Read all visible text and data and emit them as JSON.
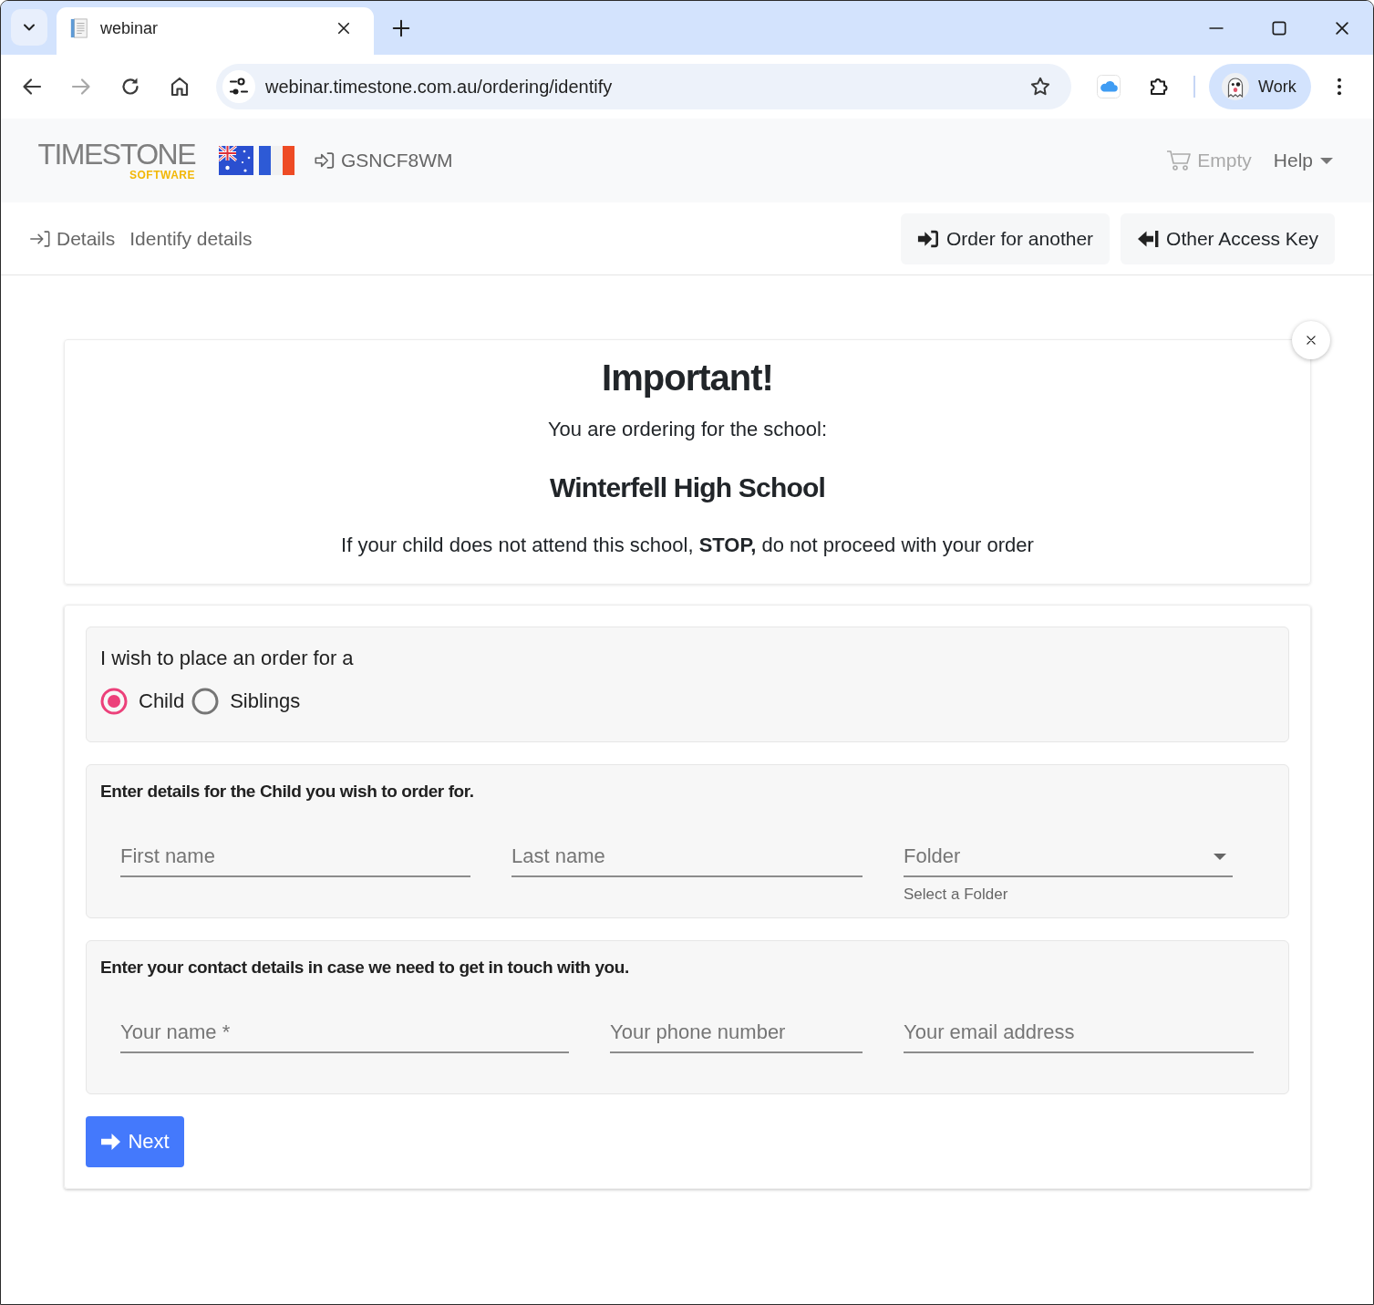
{
  "browser": {
    "tabs": [
      {
        "title": "webinar",
        "selected": true
      }
    ],
    "navigation": [
      {
        "kind": "back",
        "disabled": false
      },
      {
        "kind": "forward",
        "disabled": true
      },
      {
        "kind": "reload",
        "disabled": false
      },
      {
        "kind": "home",
        "disabled": false
      }
    ],
    "address": "webinar.timestone.com.au/ordering/identify",
    "profile": "Work"
  },
  "header": {
    "logo": {
      "wordmark": "TIMESTONE",
      "tagline": "SOFTWARE"
    },
    "access_code": "GSNCF8WM",
    "cart": "Empty",
    "help": "Help"
  },
  "subheader": {
    "section": "Details",
    "page": "Identify details",
    "buttons": [
      {
        "kind": "sign-in",
        "label": "Order for another"
      },
      {
        "kind": "back",
        "label": "Other Access Key"
      }
    ]
  },
  "notice": {
    "title": "Important!",
    "intro": "You are ordering for the school:",
    "school": "Winterfell High School",
    "warning": "If your child does not attend this school, **STOP,** do not proceed with your order"
  },
  "order_type": {
    "label": "I wish to place an order for a",
    "options": [
      {
        "label": "Child",
        "selected": true
      },
      {
        "label": "Siblings",
        "selected": false
      }
    ]
  },
  "child_details": {
    "heading": "Enter details for the Child you wish to order for.",
    "fields": [
      {
        "kind": "text",
        "placeholder": "First name"
      },
      {
        "kind": "text",
        "placeholder": "Last name"
      },
      {
        "kind": "select",
        "placeholder": "Folder",
        "hint": "Select a Folder"
      }
    ]
  },
  "contact_details": {
    "heading": "Enter your contact details in case we need to get in touch with you.",
    "fields": [
      {
        "kind": "text",
        "placeholder": "Your name *"
      },
      {
        "kind": "text",
        "placeholder": "Your phone number"
      },
      {
        "kind": "text",
        "placeholder": "Your email address"
      }
    ]
  },
  "next_button": {
    "label": "Next"
  }
}
